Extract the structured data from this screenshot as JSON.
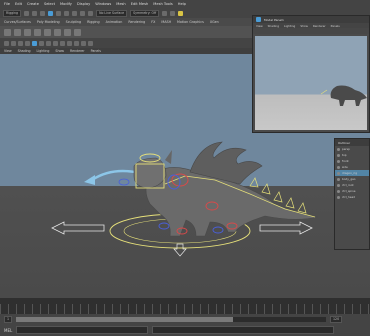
{
  "menubar": {
    "items": [
      "File",
      "Edit",
      "Create",
      "Select",
      "Modify",
      "Display",
      "Windows",
      "Mesh",
      "Edit Mesh",
      "Mesh Tools",
      "Help"
    ]
  },
  "status": {
    "mode": "Rigging",
    "no_live_surface": "No Live Surface",
    "symmetry": "Symmetry: Off"
  },
  "shelf": {
    "tabs": [
      "Curves/Surfaces",
      "Poly Modeling",
      "Sculpting",
      "Rigging",
      "Animation",
      "Rendering",
      "FX",
      "MASH",
      "Motion Graphics",
      "XGen"
    ]
  },
  "panel_menu": {
    "items": [
      "View",
      "Shading",
      "Lighting",
      "Show",
      "Renderer",
      "Panels"
    ]
  },
  "persp_window": {
    "title": "Model Panel1",
    "menu": [
      "View",
      "Shading",
      "Lighting",
      "Show",
      "Renderer",
      "Panels"
    ]
  },
  "outliner": {
    "title": "Outliner",
    "rows": [
      "persp",
      "top",
      "front",
      "side",
      "dragon_rig",
      "body_geo",
      "ctrl_root",
      "ctrl_spine",
      "ctrl_head"
    ]
  },
  "range": {
    "start": "1",
    "end": "120"
  },
  "cmdline": {
    "label": "MEL"
  },
  "colors": {
    "accent": "#4a9cd6",
    "selection": "#5285a6",
    "rig_yellow": "#e6e07a",
    "rig_red": "#d84a4a",
    "rig_blue": "#4a5fd8",
    "arrow_blue": "#8cc6e8"
  }
}
